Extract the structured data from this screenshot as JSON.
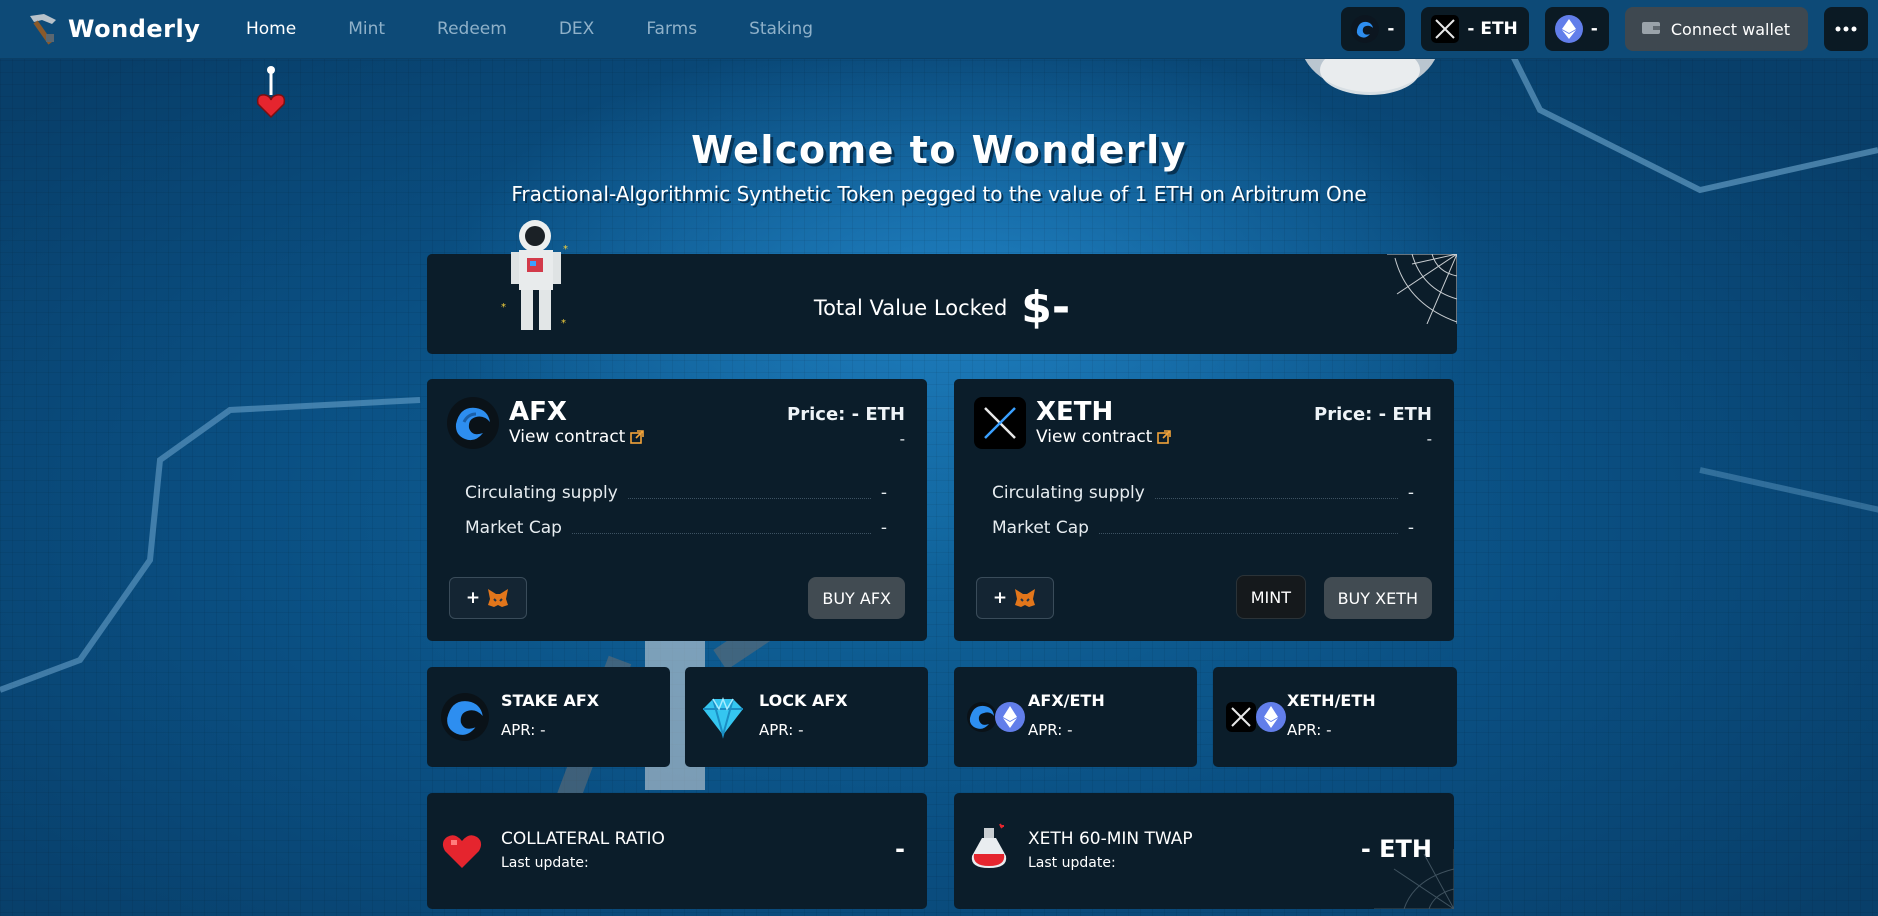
{
  "header": {
    "brand": "Wonderly",
    "nav": [
      {
        "label": "Home",
        "active": true
      },
      {
        "label": "Mint",
        "active": false
      },
      {
        "label": "Redeem",
        "active": false
      },
      {
        "label": "DEX",
        "active": false
      },
      {
        "label": "Farms",
        "active": false
      },
      {
        "label": "Staking",
        "active": false
      }
    ],
    "afx_price": "-",
    "xeth_price": "- ETH",
    "eth_price": "-",
    "connect_label": "Connect wallet",
    "more_icon": "more-dots-icon"
  },
  "hero": {
    "title": "Welcome to Wonderly",
    "subtitle": "Fractional-Algorithmic Synthetic Token pegged to the value of 1 ETH on Arbitrum One"
  },
  "tvl": {
    "label": "Total Value Locked",
    "value": "$-"
  },
  "tokens": [
    {
      "name": "AFX",
      "link": "View contract",
      "price": "Price: - ETH",
      "price_sub": "-",
      "circulating_label": "Circulating supply",
      "circulating_value": "-",
      "mcap_label": "Market Cap",
      "mcap_value": "-",
      "add_label": "+",
      "buy_label": "BUY AFX"
    },
    {
      "name": "XETH",
      "link": "View contract",
      "price": "Price: - ETH",
      "price_sub": "-",
      "circulating_label": "Circulating supply",
      "circulating_value": "-",
      "mcap_label": "Market Cap",
      "mcap_value": "-",
      "add_label": "+",
      "mint_label": "MINT",
      "buy_label": "BUY XETH"
    }
  ],
  "pools": [
    {
      "title": "STAKE AFX",
      "apr": "APR: -"
    },
    {
      "title": "LOCK AFX",
      "apr": "APR: -"
    },
    {
      "title": "AFX/ETH",
      "apr": "APR: -"
    },
    {
      "title": "XETH/ETH",
      "apr": "APR: -"
    }
  ],
  "metrics": [
    {
      "title": "COLLATERAL RATIO",
      "sub": "Last update:",
      "value": "-"
    },
    {
      "title": "XETH 60-MIN TWAP",
      "sub": "Last update:",
      "value": "- ETH"
    }
  ],
  "colors": {
    "accent_link": "#f2a33a",
    "panel": "#0b1d2a",
    "background": "#0a5a8f"
  }
}
